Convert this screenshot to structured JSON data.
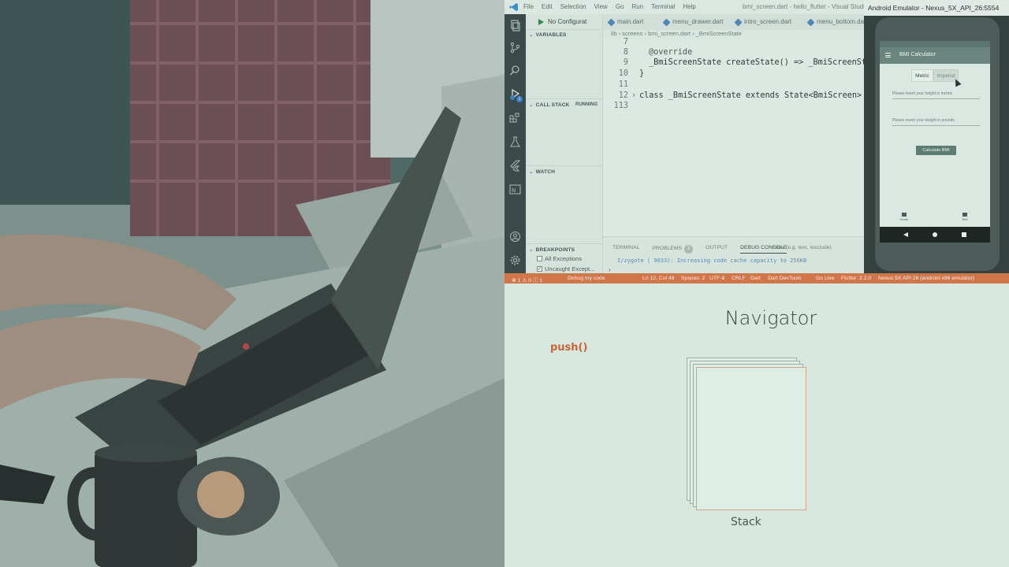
{
  "vscode": {
    "menu": [
      "File",
      "Edit",
      "Selection",
      "View",
      "Go",
      "Run",
      "Terminal",
      "Help"
    ],
    "window_title": "bmi_screen.dart - hello_flutter - Visual Studio Code",
    "run_config": "No Configurat",
    "activity_badge": "1",
    "sections": {
      "variables": "VARIABLES",
      "call_stack": "CALL STACK",
      "running": "RUNNING",
      "watch": "WATCH",
      "breakpoints": "BREAKPOINTS"
    },
    "breakpoints": [
      {
        "label": "All Exceptions",
        "checked": false
      },
      {
        "label": "Uncaught Except...",
        "checked": true
      }
    ],
    "tabs": [
      "main.dart",
      "menu_drawer.dart",
      "intro_screen.dart",
      "menu_bottom.dart"
    ],
    "breadcrumbs": "lib › screens ›  bmi_screen.dart ›  _BmiScreenState",
    "code_lines": [
      {
        "num": "7",
        "text": ""
      },
      {
        "num": "8",
        "text": "@override"
      },
      {
        "num": "9",
        "text": "_BmiScreenState createState() => _BmiScreenState"
      },
      {
        "num": "10",
        "text": "}"
      },
      {
        "num": "11",
        "text": ""
      },
      {
        "num": "12",
        "text": "class _BmiScreenState extends State<BmiScreen> {…"
      },
      {
        "num": "113",
        "text": ""
      }
    ],
    "panel": {
      "tabs": [
        "TERMINAL",
        "PROBLEMS",
        "OUTPUT",
        "DEBUG CONSOLE"
      ],
      "problems_count": "2",
      "filter_placeholder": "Filter (e.g. text, !exclude)",
      "output_line": "I/zygote  ( 9033): Increasing code cache capacity to 256KB"
    }
  },
  "statusbar": {
    "errors": "⊗ 1 ⚠ 0 ⓘ 1",
    "debug": "Debug my code",
    "position": "Ln 12, Col 49",
    "spaces": "Spaces: 2",
    "encoding": "UTF-8",
    "eol": "CRLF",
    "language": "Dart",
    "devtools": "Dart DevTools",
    "golive": "Go Live",
    "flutter": "Flutter: 2.2.0",
    "device": "Nexus 5X API 26 (android-x86 emulator)"
  },
  "emulator": {
    "title": "Android Emulator - Nexus_5X_API_26:5554",
    "app_title": "BMI Calculator",
    "toggle": [
      "Metric",
      "Imperial"
    ],
    "height_placeholder": "Please insert your height in inches",
    "weight_placeholder": "Please insert your weight in pounds",
    "calc_button": "Calculate BMI",
    "nav": [
      "Home",
      "BMI"
    ]
  },
  "slide": {
    "title": "Navigator",
    "push_label": "push()",
    "stack_label": "Stack"
  },
  "colors": {
    "statusbar_accent": "#d0764a",
    "push_color": "#c8643a",
    "slide_bg": "#d8e8de"
  }
}
